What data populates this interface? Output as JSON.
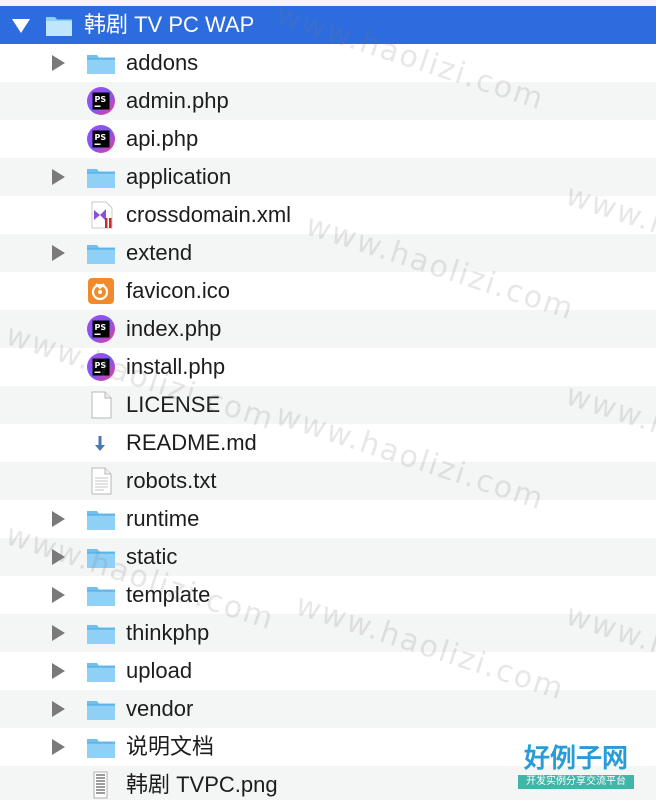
{
  "folder": {
    "name": "韩剧 TV PC WAP",
    "expanded": true
  },
  "items": [
    {
      "name": "addons",
      "kind": "folder",
      "icon": "folder-icon"
    },
    {
      "name": "admin.php",
      "kind": "file",
      "icon": "phpstorm-file-icon",
      "badge": "PS"
    },
    {
      "name": "api.php",
      "kind": "file",
      "icon": "phpstorm-file-icon",
      "badge": "PS"
    },
    {
      "name": "application",
      "kind": "folder",
      "icon": "folder-icon"
    },
    {
      "name": "crossdomain.xml",
      "kind": "file",
      "icon": "visual-studio-xml-icon"
    },
    {
      "name": "extend",
      "kind": "folder",
      "icon": "folder-icon"
    },
    {
      "name": "favicon.ico",
      "kind": "file",
      "icon": "favicon-image-icon"
    },
    {
      "name": "index.php",
      "kind": "file",
      "icon": "phpstorm-file-icon",
      "badge": "PS"
    },
    {
      "name": "install.php",
      "kind": "file",
      "icon": "phpstorm-file-icon",
      "badge": "PS"
    },
    {
      "name": "LICENSE",
      "kind": "file",
      "icon": "blank-document-icon"
    },
    {
      "name": "README.md",
      "kind": "file",
      "icon": "markdown-download-icon"
    },
    {
      "name": "robots.txt",
      "kind": "file",
      "icon": "text-document-icon"
    },
    {
      "name": "runtime",
      "kind": "folder",
      "icon": "folder-icon"
    },
    {
      "name": "static",
      "kind": "folder",
      "icon": "folder-icon"
    },
    {
      "name": "template",
      "kind": "folder",
      "icon": "folder-icon"
    },
    {
      "name": "thinkphp",
      "kind": "folder",
      "icon": "folder-icon"
    },
    {
      "name": "upload",
      "kind": "folder",
      "icon": "folder-icon"
    },
    {
      "name": "vendor",
      "kind": "folder",
      "icon": "folder-icon"
    },
    {
      "name": "说明文档",
      "kind": "folder",
      "icon": "folder-icon"
    },
    {
      "name": "韩剧 TVPC.png",
      "kind": "file",
      "icon": "image-thumbnail-icon"
    }
  ],
  "watermark": {
    "text": "www.haolizi.com"
  },
  "brand": {
    "title": "好例子网",
    "subtitle": "开发实例分享交流平台"
  },
  "colors": {
    "selection": "#2c6cde",
    "folder": "#5fb6ea",
    "stripe": "#f4f5f5",
    "brand": "#2a9bd6",
    "brand_sub": "#3fb6a8"
  }
}
